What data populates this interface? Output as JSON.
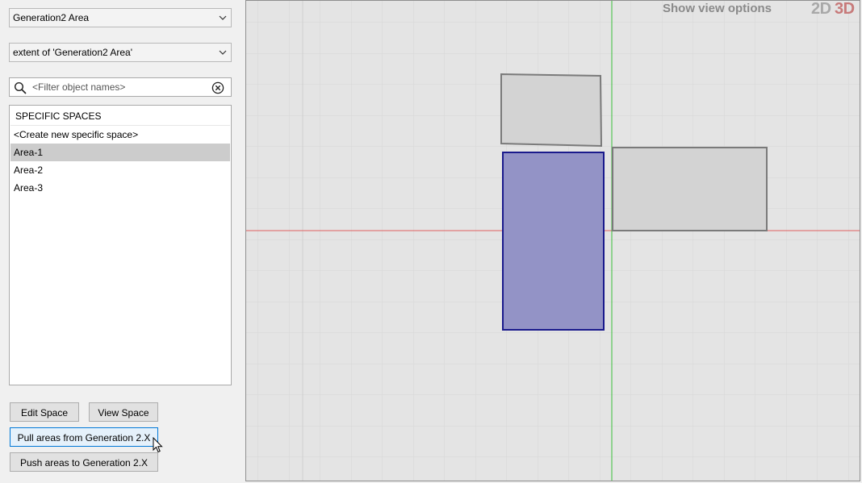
{
  "left_panel": {
    "generation_dropdown": {
      "value": "Generation2 Area"
    },
    "extent_dropdown": {
      "value": "extent of 'Generation2 Area'"
    },
    "filter": {
      "placeholder": "<Filter object names>",
      "value": ""
    },
    "list": {
      "header": "SPECIFIC SPACES",
      "items": [
        {
          "label": "<Create new specific space>",
          "selected": false
        },
        {
          "label": "Area-1",
          "selected": true
        },
        {
          "label": "Area-2",
          "selected": false
        },
        {
          "label": "Area-3",
          "selected": false
        }
      ]
    },
    "buttons": {
      "edit_space": "Edit Space",
      "view_space": "View Space",
      "pull_areas": "Pull areas from Generation 2.X",
      "push_areas": "Push areas to Generation 2.X"
    }
  },
  "viewport": {
    "show_view_options": "Show view options",
    "mode_2d": "2D",
    "mode_3d": "3D",
    "colors": {
      "background": "#e4e4e4",
      "grid": "#d6d6d6",
      "x_axis": "#e06060",
      "y_axis": "#38c038",
      "selected_fill": "#9393c6",
      "selected_stroke": "#1a1a8c",
      "area_fill": "#d3d3d3",
      "area_stroke": "#7a7a7a"
    }
  },
  "icons": {
    "search": "search-icon",
    "clear": "clear-circle-x-icon",
    "dropdown": "chevron-down-icon",
    "cursor": "mouse-pointer-icon"
  }
}
